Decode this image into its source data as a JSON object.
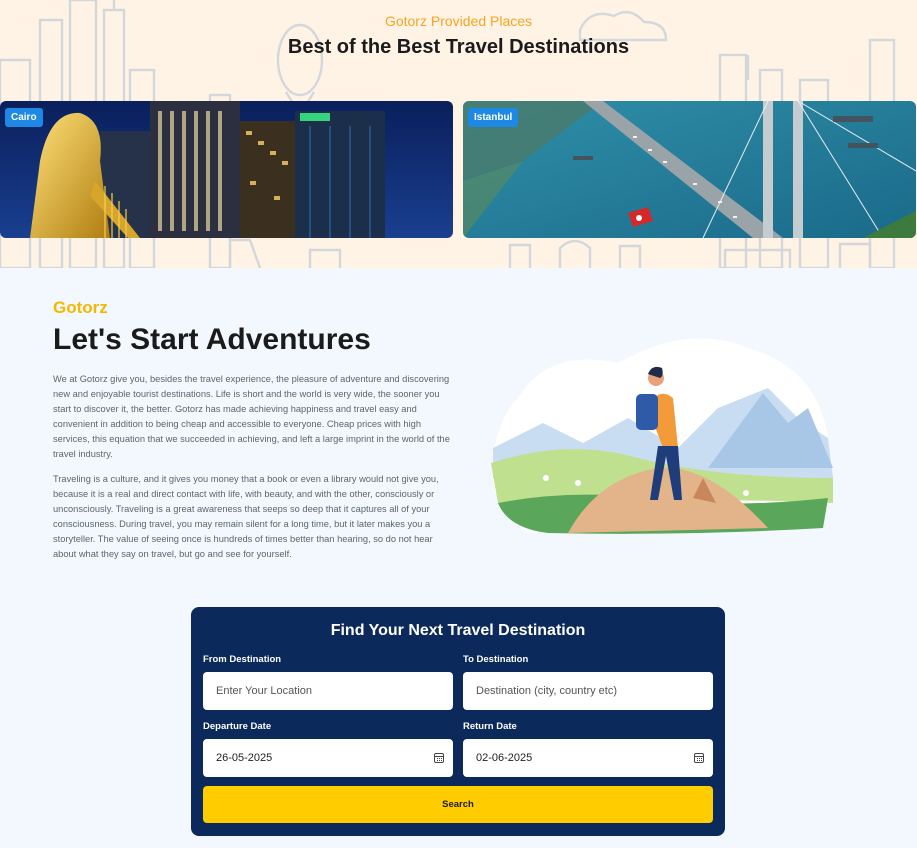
{
  "top": {
    "eyebrow": "Gotorz Provided Places",
    "headline": "Best of the Best Travel Destinations",
    "destinations": [
      {
        "label": "Cairo"
      },
      {
        "label": "Istanbul"
      }
    ]
  },
  "adventure": {
    "brand": "Gotorz",
    "title": "Let's Start Adventures",
    "paragraphs": [
      "We at Gotorz give you, besides the travel experience, the pleasure of adventure and discovering new and enjoyable tourist destinations. Life is short and the world is very wide, the sooner you start to discover it, the better. Gotorz has made achieving happiness and travel easy and convenient in addition to being cheap and accessible to everyone. Cheap prices with high services, this equation that we succeeded in achieving, and left a large imprint in the world of the travel industry.",
      "Traveling is a culture, and it gives you money that a book or even a library would not give you, because it is a real and direct contact with life, with beauty, and with the other, consciously or unconsciously. Traveling is a great awareness that seeps so deep that it captures all of your consciousness. During travel, you may remain silent for a long time, but it later makes you a storyteller. The value of seeing once is hundreds of times better than hearing, so do not hear about what they say on travel, but go and see for yourself."
    ]
  },
  "search": {
    "title": "Find Your Next Travel Destination",
    "from_label": "From Destination",
    "from_placeholder": "Enter Your Location",
    "to_label": "To Destination",
    "to_placeholder": "Destination (city, country etc)",
    "departure_label": "Departure Date",
    "departure_value": "26-05-2025",
    "return_label": "Return Date",
    "return_value": "02-06-2025",
    "button_label": "Search"
  },
  "icons": {
    "calendar": "calendar-icon"
  },
  "colors": {
    "accent_orange": "#f5a524",
    "brand_yellow": "#f5b800",
    "panel_navy": "#0b2a5b",
    "button_yellow": "#ffcc00",
    "badge_blue": "#1e88e5"
  }
}
